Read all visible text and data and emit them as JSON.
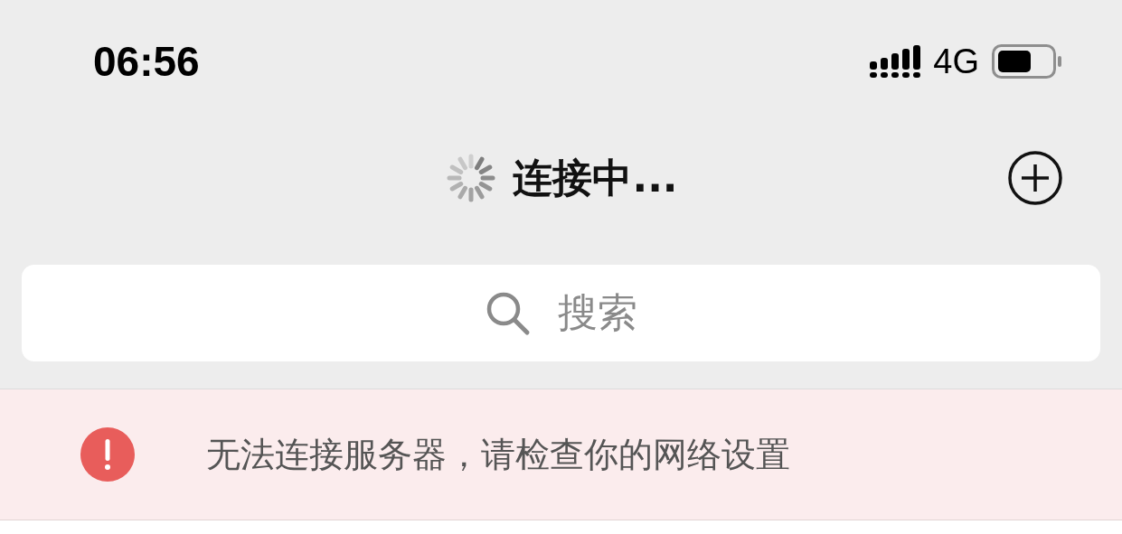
{
  "status_bar": {
    "time": "06:56",
    "network": "4G"
  },
  "nav": {
    "title": "连接中...",
    "loading": true
  },
  "search": {
    "placeholder": "搜索"
  },
  "banner": {
    "message": "无法连接服务器，请检查你的网络设置"
  }
}
